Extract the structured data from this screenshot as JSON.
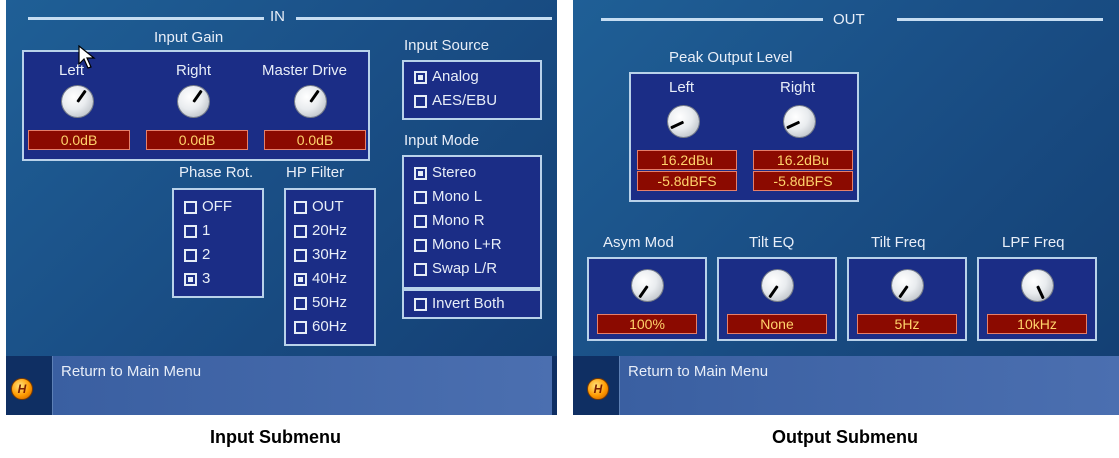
{
  "input": {
    "section_title": "IN",
    "input_gain": {
      "title": "Input Gain",
      "knobs": [
        {
          "label": "Left",
          "value": "0.0dB"
        },
        {
          "label": "Right",
          "value": "0.0dB"
        },
        {
          "label": "Master Drive",
          "value": "0.0dB"
        }
      ]
    },
    "input_source": {
      "title": "Input Source",
      "options": [
        {
          "label": "Analog",
          "checked": true
        },
        {
          "label": "AES/EBU",
          "checked": false
        }
      ]
    },
    "input_mode": {
      "title": "Input Mode",
      "options": [
        {
          "label": "Stereo",
          "checked": true
        },
        {
          "label": "Mono L",
          "checked": false
        },
        {
          "label": "Mono R",
          "checked": false
        },
        {
          "label": "Mono L+R",
          "checked": false
        },
        {
          "label": "Swap L/R",
          "checked": false
        }
      ],
      "invert": {
        "label": "Invert Both",
        "checked": false
      }
    },
    "phase_rot": {
      "title": "Phase Rot.",
      "options": [
        {
          "label": "OFF",
          "checked": false
        },
        {
          "label": "1",
          "checked": false
        },
        {
          "label": "2",
          "checked": false
        },
        {
          "label": "3",
          "checked": true
        }
      ]
    },
    "hp_filter": {
      "title": "HP Filter",
      "options": [
        {
          "label": "OUT",
          "checked": false
        },
        {
          "label": "20Hz",
          "checked": false
        },
        {
          "label": "30Hz",
          "checked": false
        },
        {
          "label": "40Hz",
          "checked": true
        },
        {
          "label": "50Hz",
          "checked": false
        },
        {
          "label": "60Hz",
          "checked": false
        }
      ]
    },
    "footer": {
      "button_label": "H",
      "text": "Return to Main Menu"
    },
    "caption": "Input Submenu"
  },
  "output": {
    "section_title": "OUT",
    "peak_output": {
      "title": "Peak Output Level",
      "knobs": [
        {
          "label": "Left",
          "value_dbu": "16.2dBu",
          "value_dbfs": "-5.8dBFS"
        },
        {
          "label": "Right",
          "value_dbu": "16.2dBu",
          "value_dbfs": "-5.8dBFS"
        }
      ]
    },
    "controls": [
      {
        "label": "Asym Mod",
        "value": "100%"
      },
      {
        "label": "Tilt EQ",
        "value": "None"
      },
      {
        "label": "Tilt Freq",
        "value": "5Hz"
      },
      {
        "label": "LPF Freq",
        "value": "10kHz"
      }
    ],
    "footer": {
      "button_label": "H",
      "text": "Return to Main Menu"
    },
    "caption": "Output Submenu"
  },
  "colors": {
    "panel_bg": "#1a4f86",
    "box_bg": "#1b2d86",
    "value_bg": "#8b0a00",
    "value_text": "#ffd36b",
    "help_button": "#ff9a00"
  },
  "icons": {
    "help": "help-button-icon",
    "cursor": "mouse-pointer-icon",
    "knob": "rotary-knob-icon"
  }
}
